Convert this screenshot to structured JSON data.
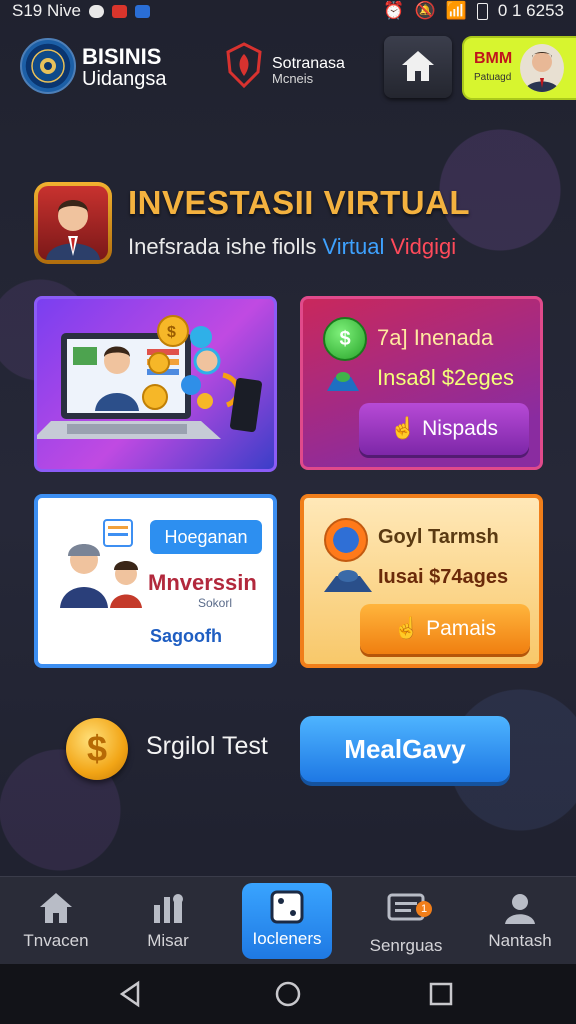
{
  "status_bar": {
    "left_text": "S19 Nive",
    "right_text": "0 1 6253"
  },
  "header": {
    "brand_title": "BISINIS",
    "brand_subtitle": "Uidangsa",
    "partner_title": "Sotranasa",
    "partner_subtitle": "Mcneis",
    "badge_title": "BMM",
    "badge_subtitle": "Patuagd"
  },
  "hero": {
    "title": "INVESTASII VIRTUAL",
    "subtitle_plain": "Inefsrada ishe fiolls ",
    "subtitle_blue": "Virtual",
    "subtitle_red": " Vidgigi"
  },
  "card2": {
    "row1": "7a] Inenada",
    "row2": "Insa8l $2eges",
    "button": "Nispads"
  },
  "card3": {
    "tag": "Hoeganan",
    "title": "Mnverssin",
    "small": "Sokorl",
    "footer": "Sagoofh"
  },
  "card4": {
    "row1": "Goyl Tarmsh",
    "row2": "Iusai $74ages",
    "button": "Pamais"
  },
  "bottom": {
    "coin_symbol": "$",
    "label": "Srgilol Test",
    "cta": "MealGavy"
  },
  "nav": {
    "items": [
      {
        "label": "Tnvacen",
        "icon": "home-icon"
      },
      {
        "label": "Misar",
        "icon": "stats-icon"
      },
      {
        "label": "Iocleners",
        "icon": "dice-icon"
      },
      {
        "label": "Senrguas",
        "icon": "mail-icon",
        "badge": "1"
      },
      {
        "label": "Nantash",
        "icon": "profile-icon"
      }
    ]
  },
  "colors": {
    "accent_gold": "#f4b23f",
    "accent_blue": "#2d8ff0",
    "badge_lime": "#d7f52f"
  }
}
